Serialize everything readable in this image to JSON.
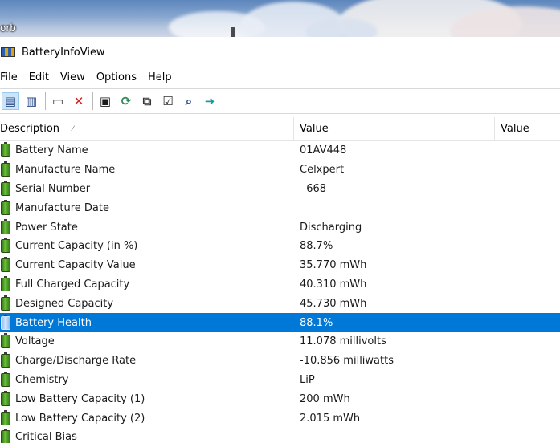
{
  "desktop": {
    "label": "orb"
  },
  "window": {
    "title": "BatteryInfoView"
  },
  "menu": [
    "File",
    "Edit",
    "View",
    "Options",
    "Help"
  ],
  "toolbar": [
    {
      "name": "html-report-icon",
      "glyph": "▤",
      "color": "#2b4c8c"
    },
    {
      "name": "properties-list-icon",
      "glyph": "▥",
      "color": "#2b4c8c"
    },
    {
      "name": "columns-icon",
      "glyph": "▭",
      "color": "#333333"
    },
    {
      "name": "delete-icon",
      "glyph": "✕",
      "color": "#d81e1e"
    },
    {
      "name": "save-icon",
      "glyph": "▣",
      "color": "#1a1a1a"
    },
    {
      "name": "refresh-icon",
      "glyph": "⟳",
      "color": "#2e8b57"
    },
    {
      "name": "copy-icon",
      "glyph": "⧉",
      "color": "#333333"
    },
    {
      "name": "options-icon",
      "glyph": "☑",
      "color": "#333333"
    },
    {
      "name": "find-icon",
      "glyph": "⌕",
      "color": "#2b4c8c"
    },
    {
      "name": "exit-icon",
      "glyph": "➜",
      "color": "#1c9aa0"
    }
  ],
  "columns": {
    "description": "Description",
    "value": "Value",
    "value2": "Value"
  },
  "rows": [
    {
      "description": "Battery Name",
      "value": "01AV448"
    },
    {
      "description": "Manufacture Name",
      "value": "Celxpert"
    },
    {
      "description": "Serial Number",
      "value": "  668"
    },
    {
      "description": "Manufacture Date",
      "value": ""
    },
    {
      "description": "Power State",
      "value": "Discharging"
    },
    {
      "description": "Current Capacity (in %)",
      "value": "88.7%"
    },
    {
      "description": "Current Capacity Value",
      "value": "35.770 mWh"
    },
    {
      "description": "Full Charged Capacity",
      "value": "40.310 mWh"
    },
    {
      "description": "Designed Capacity",
      "value": "45.730 mWh"
    },
    {
      "description": "Battery Health",
      "value": "88.1%",
      "selected": true
    },
    {
      "description": "Voltage",
      "value": "11.078 millivolts"
    },
    {
      "description": "Charge/Discharge Rate",
      "value": "-10.856 milliwatts"
    },
    {
      "description": "Chemistry",
      "value": "LiP"
    },
    {
      "description": "Low Battery Capacity (1)",
      "value": "200 mWh"
    },
    {
      "description": "Low Battery Capacity (2)",
      "value": "2.015 mWh"
    },
    {
      "description": "Critical Bias",
      "value": ""
    }
  ]
}
